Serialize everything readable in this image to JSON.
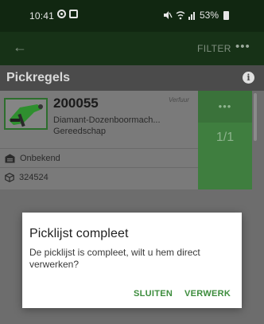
{
  "status_bar": {
    "time": "10:41",
    "battery": "53%",
    "icons": [
      "alarm-icon",
      "screen-record-icon",
      "mute-icon",
      "wifi-icon",
      "signal-icon",
      "battery-icon"
    ]
  },
  "app_bar": {
    "back_icon": "arrow-left-icon",
    "filter_label": "FILTER",
    "more_label": "•••"
  },
  "page": {
    "title": "Pickregels",
    "info_icon": "info-icon"
  },
  "pick_line": {
    "article_number": "200055",
    "tag": "Verfuur",
    "description": "Diamant-Dozenboormach...",
    "category": "Gereedschap",
    "location": "Onbekend",
    "code": "324524",
    "more_label": "•••",
    "quantity": "1/1"
  },
  "dialog": {
    "title": "Picklijst compleet",
    "message": "De picklijst is compleet, wilt u hem direct verwerken?",
    "close_label": "SLUITEN",
    "process_label": "VERWERK"
  },
  "colors": {
    "status_bar": "#112711",
    "app_bar": "#173217",
    "accent": "#3c8c3c",
    "side_panel": "#3f7e3f"
  }
}
